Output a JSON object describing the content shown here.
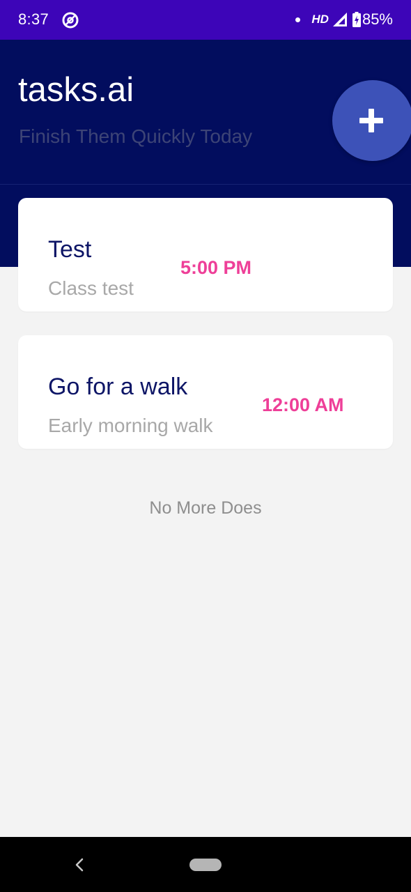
{
  "status_bar": {
    "time": "8:37",
    "app_icon": "vpn-at-icon",
    "network_label": "HD",
    "signal_icon": "signal-icon",
    "battery_icon": "battery-charging-icon",
    "battery": "85%",
    "background_color": "#3d05b8"
  },
  "header": {
    "title": "tasks.ai",
    "subtitle": "Finish Them Quickly Today",
    "background_color": "#020d5e",
    "add_button_icon": "plus-icon",
    "add_button_color": "#3d52b8"
  },
  "tasks": [
    {
      "title": "Test",
      "description": "Class test",
      "time": "5:00 PM"
    },
    {
      "title": "Go for a walk",
      "description": "Early morning walk",
      "time": "12:00 AM"
    }
  ],
  "colors": {
    "task_title": "#0d1566",
    "task_description": "#a8a8a8",
    "task_time": "#ee3f98",
    "page_background": "#f3f3f3"
  },
  "empty_message": "No More Does",
  "nav_bar": {
    "back_icon": "chevron-left-icon",
    "home_icon": "home-pill-icon"
  }
}
